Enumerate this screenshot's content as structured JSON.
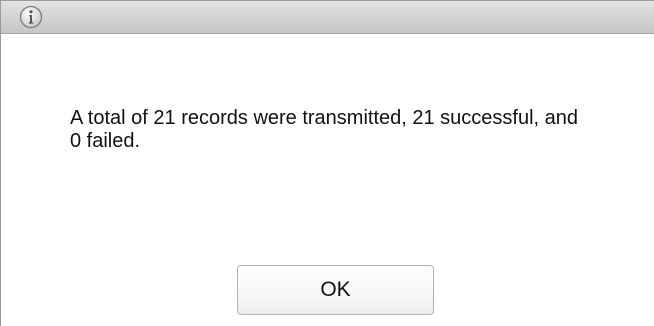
{
  "dialog": {
    "icon": "info-icon",
    "message": "A total of 21 records were transmitted, 21 successful, and 0 failed.",
    "ok_label": "OK"
  },
  "colors": {
    "titlebar": "#d2d2d2",
    "border": "#9a9a9a",
    "text": "#111111"
  }
}
